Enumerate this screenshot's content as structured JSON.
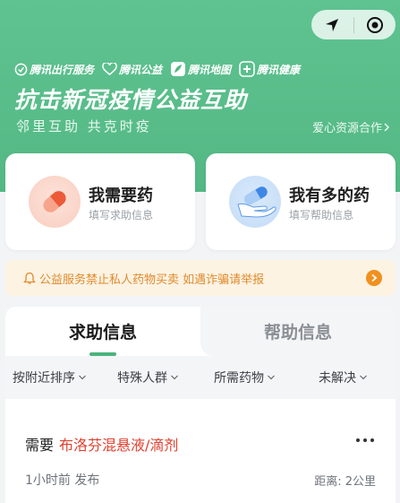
{
  "header": {
    "partners": [
      {
        "icon": "tencent-travel-icon",
        "label": "腾讯出行服务"
      },
      {
        "icon": "tencent-charity-icon",
        "label": "腾讯公益"
      },
      {
        "icon": "tencent-map-icon",
        "label": "腾讯地图"
      },
      {
        "icon": "tencent-health-icon",
        "label": "腾讯健康"
      }
    ],
    "title": "抗击新冠疫情公益互助",
    "subtitle": "邻里互助  共克时疫",
    "resource_link": "爱心资源合作",
    "capsule": {
      "left_icon": "location-arrow-icon",
      "right_icon": "target-icon"
    }
  },
  "cards": [
    {
      "title": "我需要药",
      "subtitle": "填写求助信息",
      "icon": "pill-capsule-icon",
      "color": "#e85a3c"
    },
    {
      "title": "我有多的药",
      "subtitle": "填写帮助信息",
      "icon": "hand-pill-icon",
      "color": "#3e86e6"
    }
  ],
  "notice": {
    "text": "公益服务禁止私人药物买卖 如遇诈骗请举报",
    "color": "#e08a2c"
  },
  "tabs": [
    {
      "label": "求助信息",
      "active": true
    },
    {
      "label": "帮助信息",
      "active": false
    }
  ],
  "filters": [
    {
      "label": "按附近排序"
    },
    {
      "label": "特殊人群"
    },
    {
      "label": "所需药物"
    },
    {
      "label": "未解决"
    }
  ],
  "item": {
    "prefix": "需要",
    "drug": "布洛芬混悬液/滴剂",
    "time": "1小时前 发布",
    "distance": "距离: 2公里"
  },
  "colors": {
    "brand_green": "#5fc391",
    "accent_red": "#e0412f",
    "notice_orange": "#f0901f"
  }
}
